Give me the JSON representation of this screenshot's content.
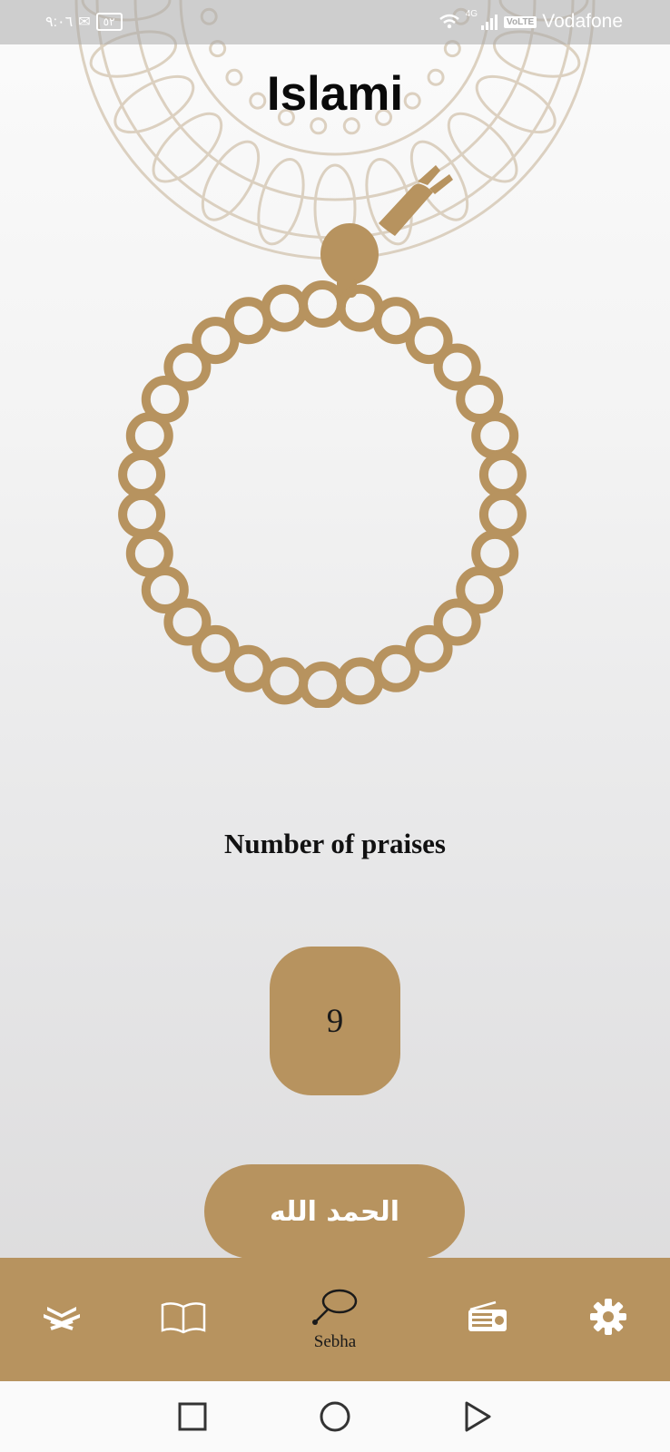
{
  "status_bar": {
    "time": "٩:٠٦",
    "battery": "٥٢",
    "network": "4G",
    "volte": "VoLTE",
    "carrier": "Vodafone"
  },
  "app": {
    "title": "Islami"
  },
  "sebha": {
    "praises_label": "Number of praises",
    "count": "9",
    "praise_button_label": "الحمد الله"
  },
  "bottom_nav": {
    "items": [
      {
        "icon": "quran-icon",
        "label": ""
      },
      {
        "icon": "book-icon",
        "label": ""
      },
      {
        "icon": "sebha-icon",
        "label": "Sebha",
        "active": true
      },
      {
        "icon": "radio-icon",
        "label": ""
      },
      {
        "icon": "settings-icon",
        "label": ""
      }
    ]
  },
  "colors": {
    "accent": "#b7935f",
    "status_bar": "#aaaaaa"
  }
}
